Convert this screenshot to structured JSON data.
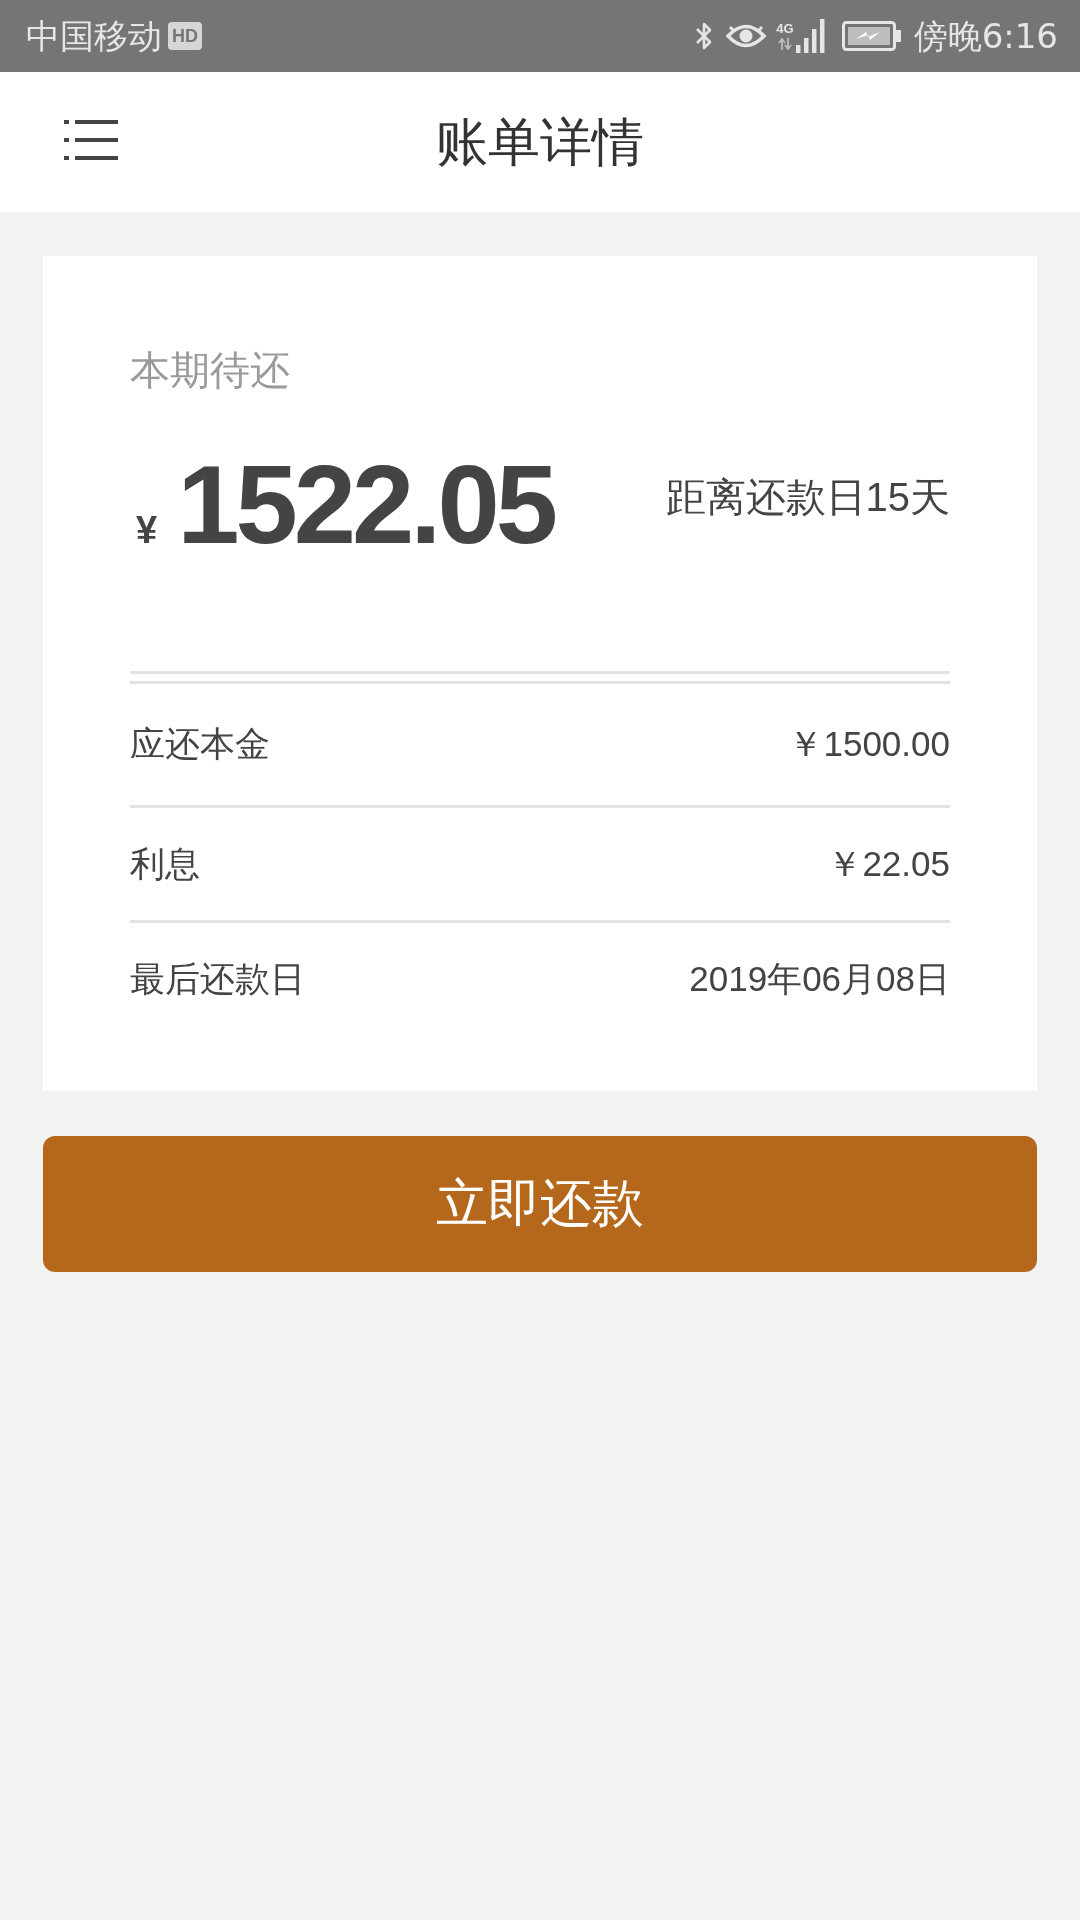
{
  "status_bar": {
    "carrier": "中国移动",
    "hd_badge": "HD",
    "network_type": "4G",
    "time": "傍晚6:16"
  },
  "header": {
    "title": "账单详情"
  },
  "summary": {
    "label": "本期待还",
    "currency": "¥",
    "amount": "1522.05",
    "countdown": "距离还款日15天"
  },
  "details": [
    {
      "label": "应还本金",
      "value": "￥1500.00"
    },
    {
      "label": "利息",
      "value": "￥22.05"
    },
    {
      "label": "最后还款日",
      "value": "2019年06月08日"
    }
  ],
  "pay_button": {
    "label": "立即还款"
  }
}
